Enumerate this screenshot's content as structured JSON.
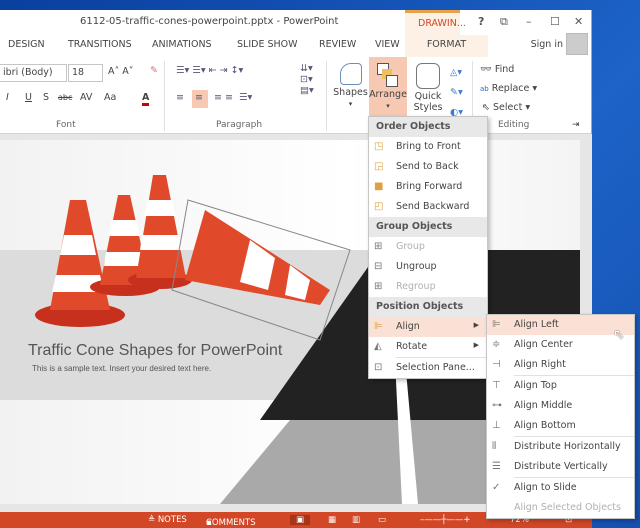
{
  "window": {
    "title": "6112-05-traffic-cones-powerpoint.pptx - PowerPoint",
    "context_tab": "DRAWIN...",
    "help": "?",
    "controls": [
      "⧉",
      "–",
      "☐",
      "✕"
    ]
  },
  "tabs": [
    "DESIGN",
    "TRANSITIONS",
    "ANIMATIONS",
    "SLIDE SHOW",
    "REVIEW",
    "VIEW"
  ],
  "format_tab": "FORMAT",
  "sign_in": "Sign in",
  "ribbon": {
    "font_name": "ibri (Body)",
    "font_size": "18",
    "font_group": "Font",
    "paragraph_group": "Paragraph",
    "editing_group": "Editing",
    "shapes": "Shapes",
    "arrange": "Arrange",
    "quick": "Quick",
    "styles": "Styles ▾",
    "find": "Find",
    "replace": "Replace",
    "select": "Select ▾",
    "font_buttons": [
      "I",
      "U",
      "S",
      "abc",
      "AV",
      "Aa",
      "A"
    ]
  },
  "slide": {
    "title": "Traffic Cone Shapes for PowerPoint",
    "subtitle": "This is a sample text. Insert your desired text here."
  },
  "status": {
    "notes": "≜ NOTES",
    "comments": "COMMENTS",
    "zoom": "72%"
  },
  "arrange_menu": {
    "order_header": "Order Objects",
    "order": [
      {
        "label": "Bring to Front",
        "icon": "bring-to-front"
      },
      {
        "label": "Send to Back",
        "icon": "send-to-back"
      },
      {
        "label": "Bring Forward",
        "icon": "bring-forward"
      },
      {
        "label": "Send Backward",
        "icon": "send-backward"
      }
    ],
    "group_header": "Group Objects",
    "group": [
      {
        "label": "Group",
        "disabled": true
      },
      {
        "label": "Ungroup",
        "disabled": false
      },
      {
        "label": "Regroup",
        "disabled": true
      }
    ],
    "position_header": "Position Objects",
    "position": [
      {
        "label": "Align"
      },
      {
        "label": "Rotate"
      },
      {
        "label": "Selection Pane..."
      }
    ]
  },
  "align_menu": {
    "items": [
      "Align Left",
      "Align Center",
      "Align Right",
      "Align Top",
      "Align Middle",
      "Align Bottom",
      "Distribute Horizontally",
      "Distribute Vertically",
      "Align to Slide",
      "Align Selected Objects"
    ]
  },
  "colors": {
    "accent": "#d24726",
    "highlight": "#f7c8b2"
  }
}
